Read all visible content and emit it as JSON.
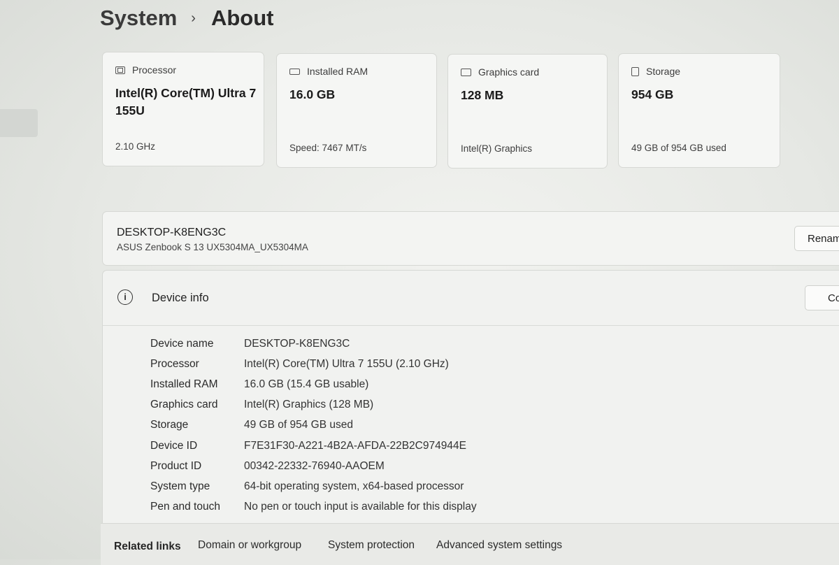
{
  "breadcrumb": {
    "parent": "System",
    "current": "About"
  },
  "spec_cards": [
    {
      "icon": "processor-icon",
      "title": "Processor",
      "value": "Intel(R) Core(TM) Ultra 7 155U",
      "sub": "2.10 GHz"
    },
    {
      "icon": "ram-icon",
      "title": "Installed RAM",
      "value": "16.0 GB",
      "sub": "Speed: 7467 MT/s"
    },
    {
      "icon": "graphics-card-icon",
      "title": "Graphics card",
      "value": "128 MB",
      "sub": "Intel(R) Graphics"
    },
    {
      "icon": "storage-icon",
      "title": "Storage",
      "value": "954 GB",
      "sub": "49 GB of 954 GB used"
    }
  ],
  "device": {
    "name": "DESKTOP-K8ENG3C",
    "model": "ASUS Zenbook S 13 UX5304MA_UX5304MA",
    "rename_label": "Renam"
  },
  "device_info": {
    "title": "Device info",
    "icon": "info-icon",
    "copy_label": "Co",
    "rows": [
      {
        "label": "Device name",
        "value": "DESKTOP-K8ENG3C"
      },
      {
        "label": "Processor",
        "value": "Intel(R) Core(TM) Ultra 7 155U (2.10 GHz)"
      },
      {
        "label": "Installed RAM",
        "value": "16.0 GB (15.4 GB usable)"
      },
      {
        "label": "Graphics card",
        "value": "Intel(R) Graphics (128 MB)"
      },
      {
        "label": "Storage",
        "value": "49 GB of 954 GB used"
      },
      {
        "label": "Device ID",
        "value": "F7E31F30-A221-4B2A-AFDA-22B2C974944E"
      },
      {
        "label": "Product ID",
        "value": "00342-22332-76940-AAOEM"
      },
      {
        "label": "System type",
        "value": "64-bit operating system, x64-based processor"
      },
      {
        "label": "Pen and touch",
        "value": "No pen or touch input is available for this display"
      }
    ]
  },
  "related_links": {
    "title": "Related links",
    "links": [
      "Domain or workgroup",
      "System protection",
      "Advanced system settings"
    ]
  }
}
